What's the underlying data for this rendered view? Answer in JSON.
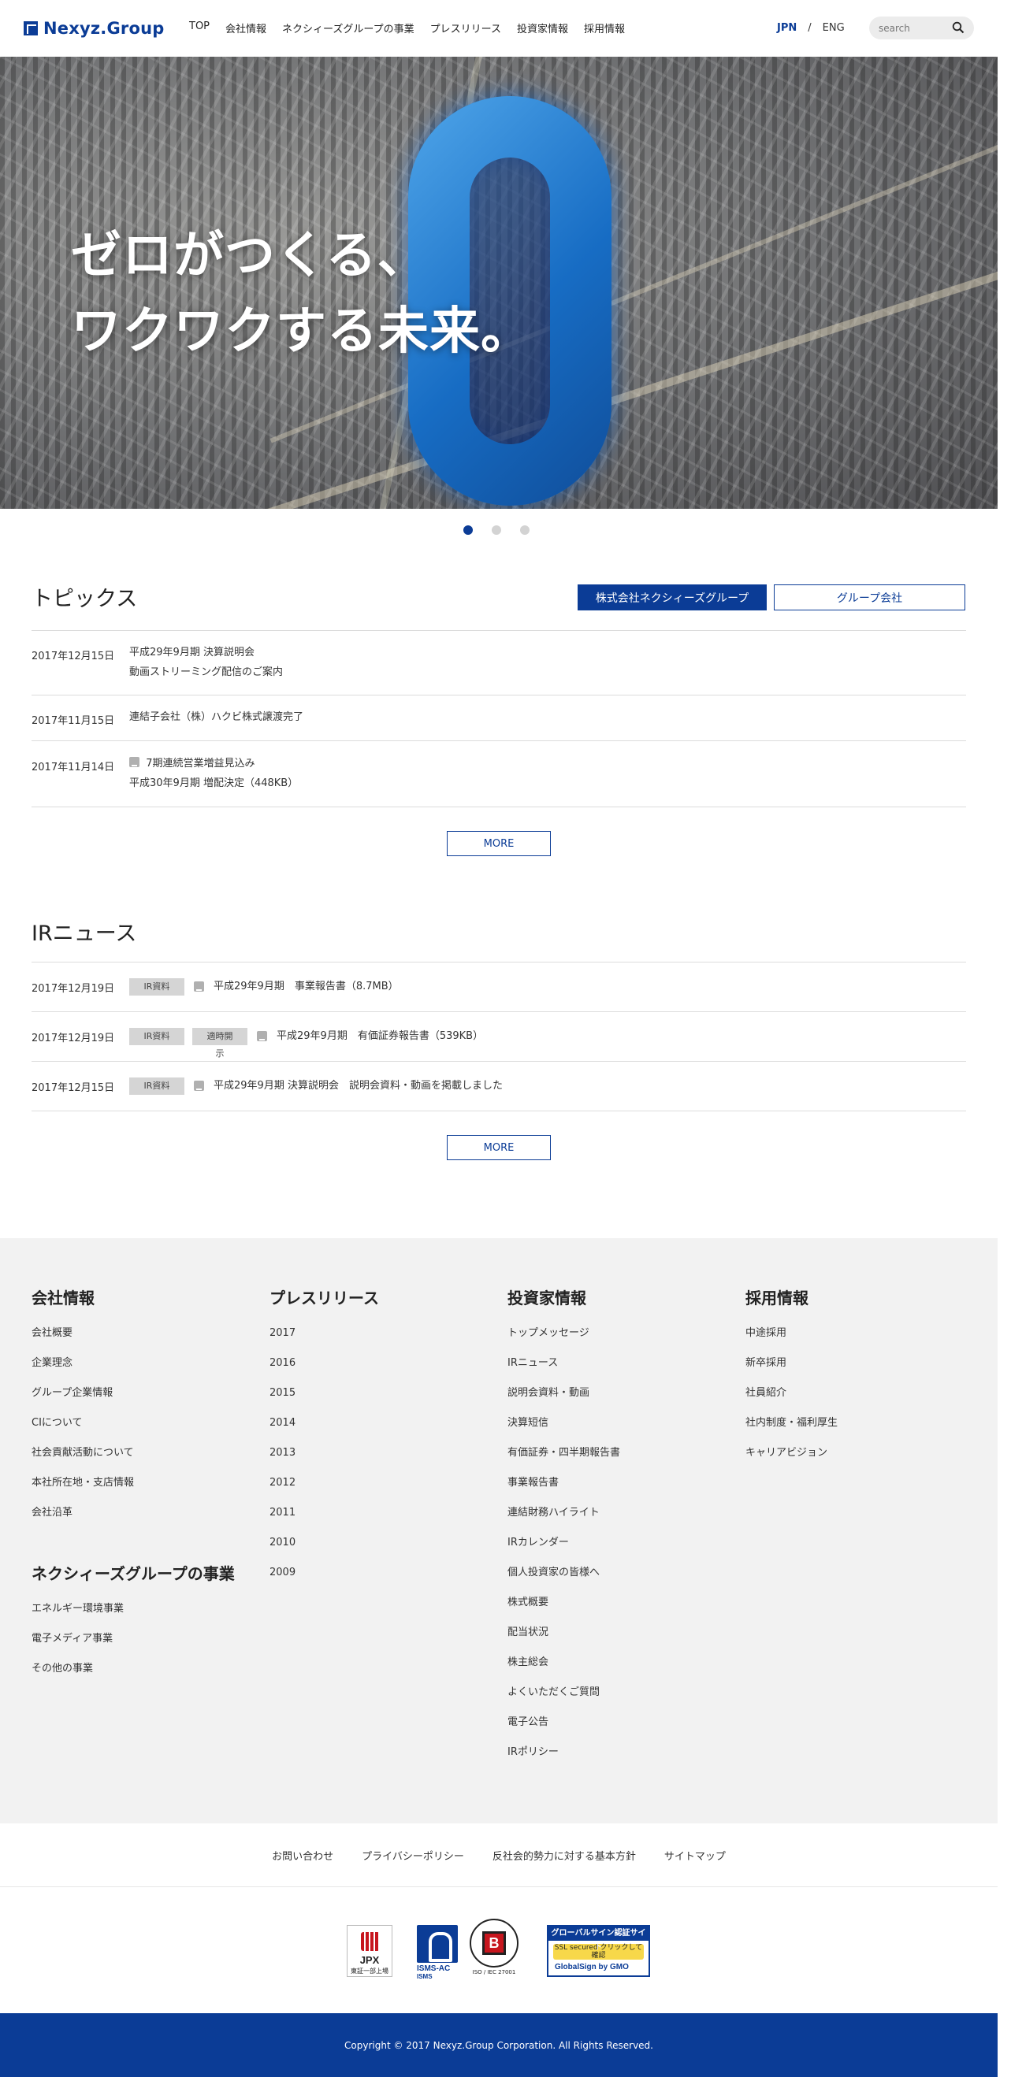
{
  "header": {
    "logo_text": "Nexyz.Group",
    "nav": [
      "TOP",
      "会社情報",
      "ネクシィーズグループの事業",
      "プレスリリース",
      "投資家情報",
      "採用情報"
    ],
    "lang_jpn": "JPN",
    "lang_sep": "/",
    "lang_eng": "ENG",
    "search_placeholder": "search"
  },
  "hero": {
    "line1": "ゼロがつくる、",
    "line2": "ワクワクする未来。",
    "slides": 3,
    "active_slide": 1
  },
  "topics": {
    "title": "トピックス",
    "filter_company": "株式会社ネクシィーズグループ",
    "filter_group": "グループ会社",
    "items": [
      {
        "date": "2017年12月15日",
        "line1": "平成29年9月期 決算説明会",
        "line2": "動画ストリーミング配信のご案内"
      },
      {
        "date": "2017年11月15日",
        "line1": "連結子会社（株）ハクビ株式譲渡完了",
        "line2": ""
      },
      {
        "date": "2017年11月14日",
        "line1": "7期連続営業増益見込み",
        "line2": "平成30年9月期 増配決定（448KB）"
      }
    ],
    "more": "MORE"
  },
  "ir_news": {
    "title": "IRニュース",
    "items": [
      {
        "date": "2017年12月19日",
        "tags": [
          "IR資料"
        ],
        "text": "平成29年9月期　事業報告書（8.7MB）"
      },
      {
        "date": "2017年12月19日",
        "tags": [
          "IR資料",
          "適時開示"
        ],
        "text": "平成29年9月期　有価証券報告書（539KB）"
      },
      {
        "date": "2017年12月15日",
        "tags": [
          "IR資料"
        ],
        "text": "平成29年9月期 決算説明会　説明会資料・動画を掲載しました"
      }
    ],
    "more": "MORE"
  },
  "footer_nav": {
    "company": {
      "title": "会社情報",
      "items": [
        "会社概要",
        "企業理念",
        "グループ企業情報",
        "CIについて",
        "社会貢献活動について",
        "本社所在地・支店情報",
        "会社沿革"
      ]
    },
    "business": {
      "title": "ネクシィーズグループの事業",
      "items": [
        "エネルギー環境事業",
        "電子メディア事業",
        "その他の事業"
      ]
    },
    "press": {
      "title": "プレスリリース",
      "items": [
        "2017",
        "2016",
        "2015",
        "2014",
        "2013",
        "2012",
        "2011",
        "2010",
        "2009"
      ]
    },
    "investors": {
      "title": "投資家情報",
      "items": [
        "トップメッセージ",
        "IRニュース",
        "説明会資料・動画",
        "決算短信",
        "有価証券・四半期報告書",
        "事業報告書",
        "連結財務ハイライト",
        "IRカレンダー",
        "個人投資家の皆様へ",
        "株式概要",
        "配当状況",
        "株主総会",
        "よくいただくご質問",
        "電子公告",
        "IRポリシー"
      ]
    },
    "recruit": {
      "title": "採用情報",
      "items": [
        "中途採用",
        "新卒採用",
        "社員紹介",
        "社内制度・福利厚生",
        "キャリアビジョン"
      ]
    }
  },
  "footer_links": [
    "お問い合わせ",
    "プライバシーポリシー",
    "反社会的勢力に対する基本方針",
    "サイトマップ"
  ],
  "badges": {
    "jpx_name": "JPX",
    "jpx_caption": "東証一部上場",
    "isms_line1": "ISMS-AC",
    "isms_line2": "ISMS",
    "iso_letter": "B",
    "iso_caption": "ISO / IEC 27001",
    "gs_title": "グローバルサイン認証サイト",
    "gs_mid": "SSL secured クリックして確認",
    "gs_brand": "GlobalSign by GMO"
  },
  "copyright": "Copyright © 2017 Nexyz.Group Corporation. All Rights Reserved.",
  "colors": {
    "brand": "#0b3c96",
    "footer_bg": "#f2f2f2"
  }
}
